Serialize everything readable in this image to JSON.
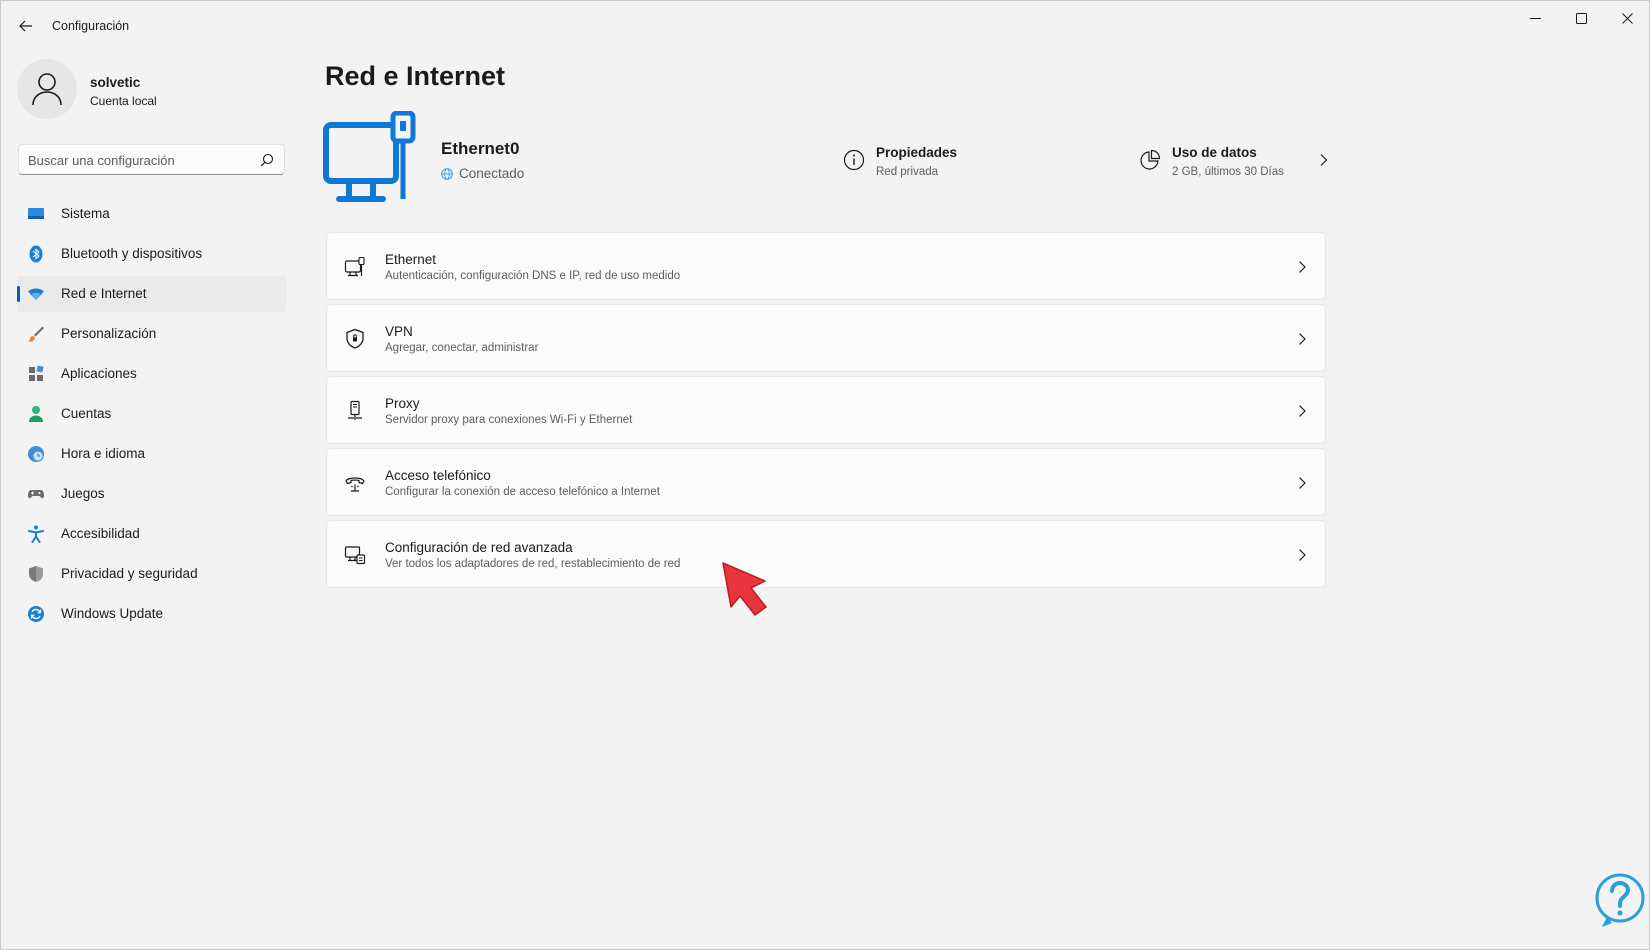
{
  "window": {
    "title": "Configuración"
  },
  "profile": {
    "name": "solvetic",
    "account_type": "Cuenta local"
  },
  "search": {
    "placeholder": "Buscar una configuración"
  },
  "nav": {
    "items": [
      {
        "label": "Sistema",
        "icon": "monitor-icon",
        "active": false
      },
      {
        "label": "Bluetooth y dispositivos",
        "icon": "bluetooth-icon",
        "active": false
      },
      {
        "label": "Red e Internet",
        "icon": "wifi-icon",
        "active": true
      },
      {
        "label": "Personalización",
        "icon": "brush-icon",
        "active": false
      },
      {
        "label": "Aplicaciones",
        "icon": "apps-icon",
        "active": false
      },
      {
        "label": "Cuentas",
        "icon": "person-icon",
        "active": false
      },
      {
        "label": "Hora e idioma",
        "icon": "clock-globe-icon",
        "active": false
      },
      {
        "label": "Juegos",
        "icon": "gamepad-icon",
        "active": false
      },
      {
        "label": "Accesibilidad",
        "icon": "accessibility-icon",
        "active": false
      },
      {
        "label": "Privacidad y seguridad",
        "icon": "shield-icon",
        "active": false
      },
      {
        "label": "Windows Update",
        "icon": "update-icon",
        "active": false
      }
    ]
  },
  "page": {
    "title": "Red e Internet"
  },
  "connection": {
    "name": "Ethernet0",
    "status": "Conectado",
    "properties": {
      "title": "Propiedades",
      "subtitle": "Red privada"
    },
    "data_usage": {
      "title": "Uso de datos",
      "subtitle": "2 GB, últimos 30 Días"
    }
  },
  "cards": [
    {
      "title": "Ethernet",
      "subtitle": "Autenticación, configuración DNS e IP, red de uso medido",
      "icon": "ethernet-icon"
    },
    {
      "title": "VPN",
      "subtitle": "Agregar, conectar, administrar",
      "icon": "vpn-shield-icon"
    },
    {
      "title": "Proxy",
      "subtitle": "Servidor proxy para conexiones Wi-Fi y Ethernet",
      "icon": "proxy-icon"
    },
    {
      "title": "Acceso telefónico",
      "subtitle": "Configurar la conexión de acceso telefónico a Internet",
      "icon": "dialup-icon"
    },
    {
      "title": "Configuración de red avanzada",
      "subtitle": "Ver todos los adaptadores de red, restablecimiento de red",
      "icon": "advanced-network-icon"
    }
  ],
  "colors": {
    "accent": "#005fb8",
    "hero_icon": "#0f78d4",
    "pointer": "#e8343a",
    "watermark": "#2a9fd8"
  }
}
